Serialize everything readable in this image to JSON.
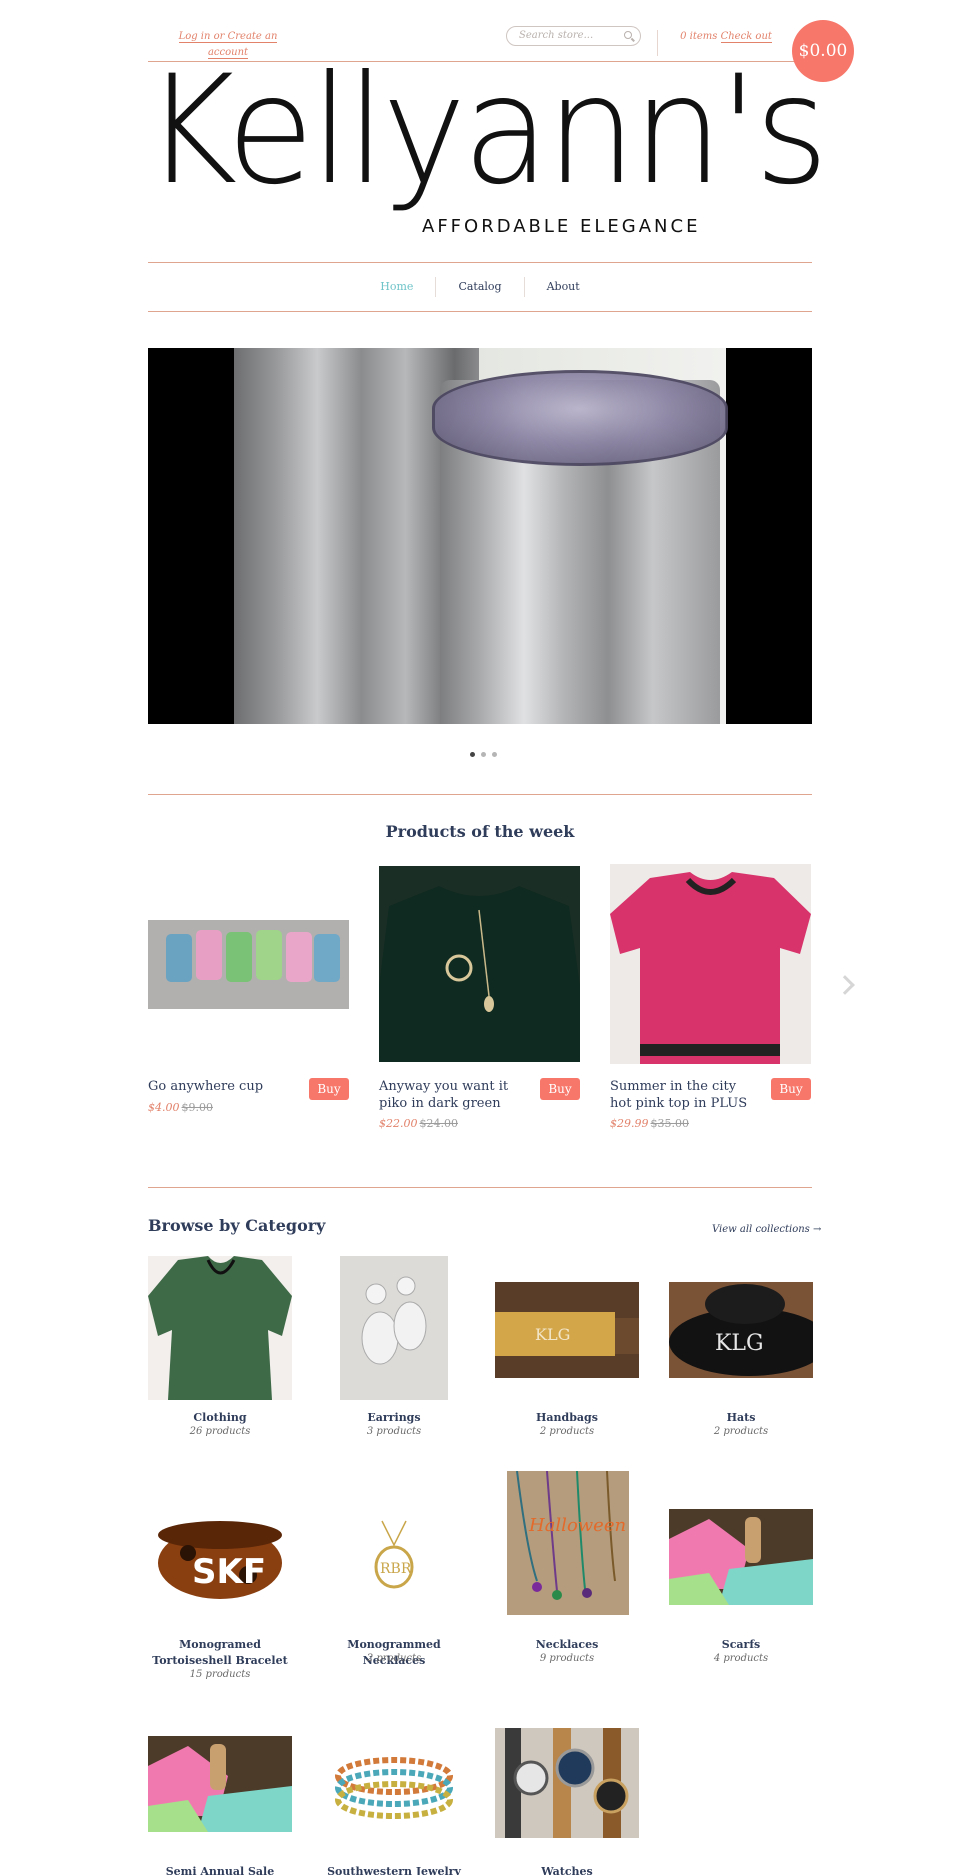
{
  "header": {
    "login_text": "Log in or Create an account",
    "search_placeholder": "Search store...",
    "cart_items": "0 items",
    "checkout": "Check out",
    "cart_total": "$0.00"
  },
  "logo": {
    "name": "Kellyann's",
    "tagline": "AFFORDABLE ELEGANCE"
  },
  "nav": {
    "items": [
      {
        "label": "Home",
        "active": true
      },
      {
        "label": "Catalog",
        "active": false
      },
      {
        "label": "About",
        "active": false
      }
    ]
  },
  "slider": {
    "dots": 3,
    "active_dot": 1
  },
  "products_section": {
    "title": "Products of the week",
    "products": [
      {
        "name": "Go anywhere cup",
        "price": "$4.00",
        "compare": "$9.00",
        "buy": "Buy"
      },
      {
        "name": "Anyway you want it piko in dark green",
        "price": "$22.00",
        "compare": "$24.00",
        "buy": "Buy"
      },
      {
        "name": "Summer in the city hot pink top in PLUS",
        "price": "$29.99",
        "compare": "$35.00",
        "buy": "Buy"
      }
    ]
  },
  "categories_section": {
    "title": "Browse by Category",
    "view_all": "View all collections →",
    "items": [
      {
        "name": "Clothing",
        "count": "26 products"
      },
      {
        "name": "Earrings",
        "count": "3 products"
      },
      {
        "name": "Handbags",
        "count": "2 products"
      },
      {
        "name": "Hats",
        "count": "2 products"
      },
      {
        "name": "Monogramed Tortoiseshell Bracelet",
        "count": "15 products"
      },
      {
        "name": "Monogrammed Necklaces",
        "count": "2 products"
      },
      {
        "name": "Necklaces",
        "count": "9 products"
      },
      {
        "name": "Scarfs",
        "count": "4 products"
      },
      {
        "name": "Semi Annual Sale",
        "count": ""
      },
      {
        "name": "Southwestern Jewelry",
        "count": ""
      },
      {
        "name": "Watches",
        "count": ""
      }
    ]
  },
  "colors": {
    "accent": "#f7776a",
    "link": "#e2826b",
    "text": "#2f3c5a",
    "nav_active": "#6fc4c9",
    "rule": "#e0a58f"
  }
}
